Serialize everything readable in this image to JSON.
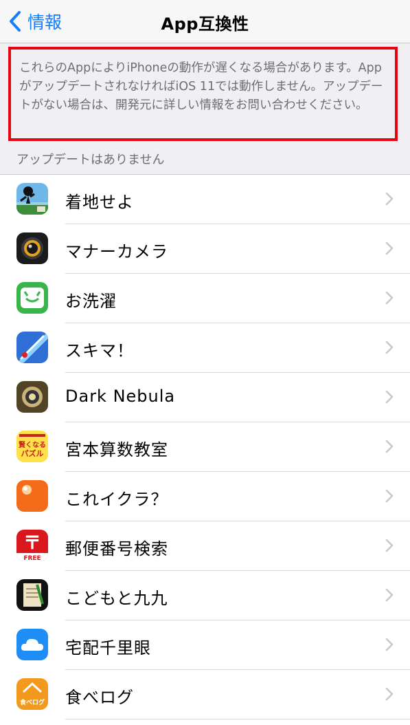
{
  "navbar": {
    "back_label": "情報",
    "title": "App互換性"
  },
  "notice": {
    "text": "これらのAppによりiPhoneの動作が遅くなる場合があります。AppがアップデートされなければiOS 11では動作しません。アップデートがない場合は、開発元に詳しい情報をお問い合わせください。"
  },
  "section": {
    "header": "アップデートはありません"
  },
  "apps": [
    {
      "name": "着地せよ",
      "icon": "jump-game-icon"
    },
    {
      "name": "マナーカメラ",
      "icon": "camera-lens-icon"
    },
    {
      "name": "お洗濯",
      "icon": "laundry-cat-icon"
    },
    {
      "name": "スキマ！",
      "icon": "sword-slash-icon"
    },
    {
      "name": "Dark Nebula",
      "icon": "dark-orb-icon"
    },
    {
      "name": "宮本算数教室",
      "icon": "puzzle-book-icon",
      "icon_text": [
        "賢くなる",
        "パズル"
      ]
    },
    {
      "name": "これイクラ？",
      "icon": "orange-ball-icon"
    },
    {
      "name": "郵便番号検索",
      "icon": "postal-mark-icon",
      "icon_text": [
        "〒",
        "FREE"
      ]
    },
    {
      "name": "こどもと九九",
      "icon": "notebook-icon"
    },
    {
      "name": "宅配千里眼",
      "icon": "cloud-icon"
    },
    {
      "name": "食べログ",
      "icon": "tabelog-icon",
      "icon_text": [
        "食べログ"
      ]
    }
  ],
  "colors": {
    "accent": "#157efb",
    "highlight_border": "#e10610",
    "background": "#efeff4"
  }
}
